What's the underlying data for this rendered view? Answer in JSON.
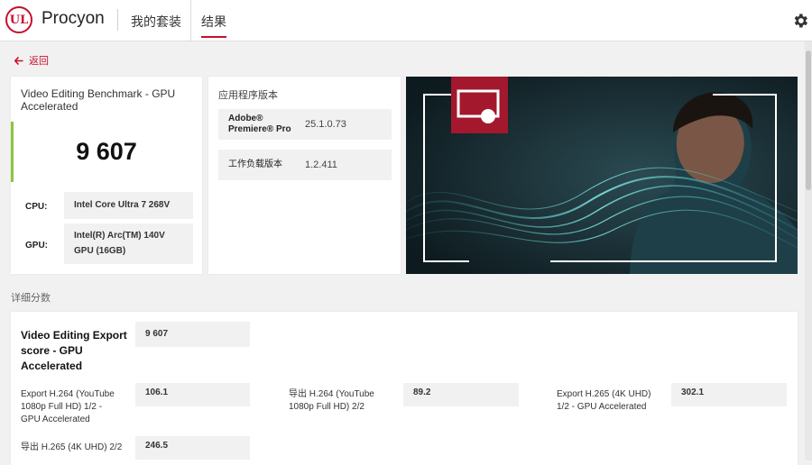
{
  "header": {
    "logo_text": "UL",
    "app_name": "Procyon",
    "tabs": [
      {
        "label": "我的套装"
      },
      {
        "label": "结果"
      }
    ]
  },
  "back_label": "返回",
  "benchmark": {
    "title": "Video Editing Benchmark - GPU Accelerated",
    "score": "9 607",
    "cpu_label": "CPU:",
    "cpu_value": "Intel Core Ultra 7 268V",
    "gpu_label": "GPU:",
    "gpu_value_line1": "Intel(R) Arc(TM) 140V",
    "gpu_value_line2": "GPU (16GB)",
    "accent_color": "#8dc63f"
  },
  "versions": {
    "title": "应用程序版本",
    "rows": [
      {
        "name_line1": "Adobe®",
        "name_line2": "Premiere® Pro",
        "value": "25.1.0.73"
      },
      {
        "name_line1": "工作负载版本",
        "name_line2": "",
        "value": "1.2.411"
      }
    ]
  },
  "details": {
    "title": "详细分数",
    "export_score_line1": "Video Editing Export",
    "export_score_line2": "score - GPU",
    "export_score_line3": "Accelerated",
    "export_score_value": "9 607",
    "items": [
      {
        "line1": "Export H.264 (YouTube",
        "line2": "1080p Full HD) 1/2 -",
        "line3": "GPU Accelerated",
        "value": "106.1"
      },
      {
        "line1": "导出 H.264 (YouTube",
        "line2": "1080p Full HD) 2/2",
        "line3": "",
        "value": "89.2"
      },
      {
        "line1": "Export H.265 (4K UHD)",
        "line2": "1/2 - GPU Accelerated",
        "line3": "",
        "value": "302.1"
      },
      {
        "line1": "导出 H.265 (4K UHD) 2/2",
        "line2": "",
        "line3": "",
        "value": "246.5"
      }
    ]
  },
  "colors": {
    "brand": "#c8102e",
    "banner_bg": "#15262c"
  }
}
